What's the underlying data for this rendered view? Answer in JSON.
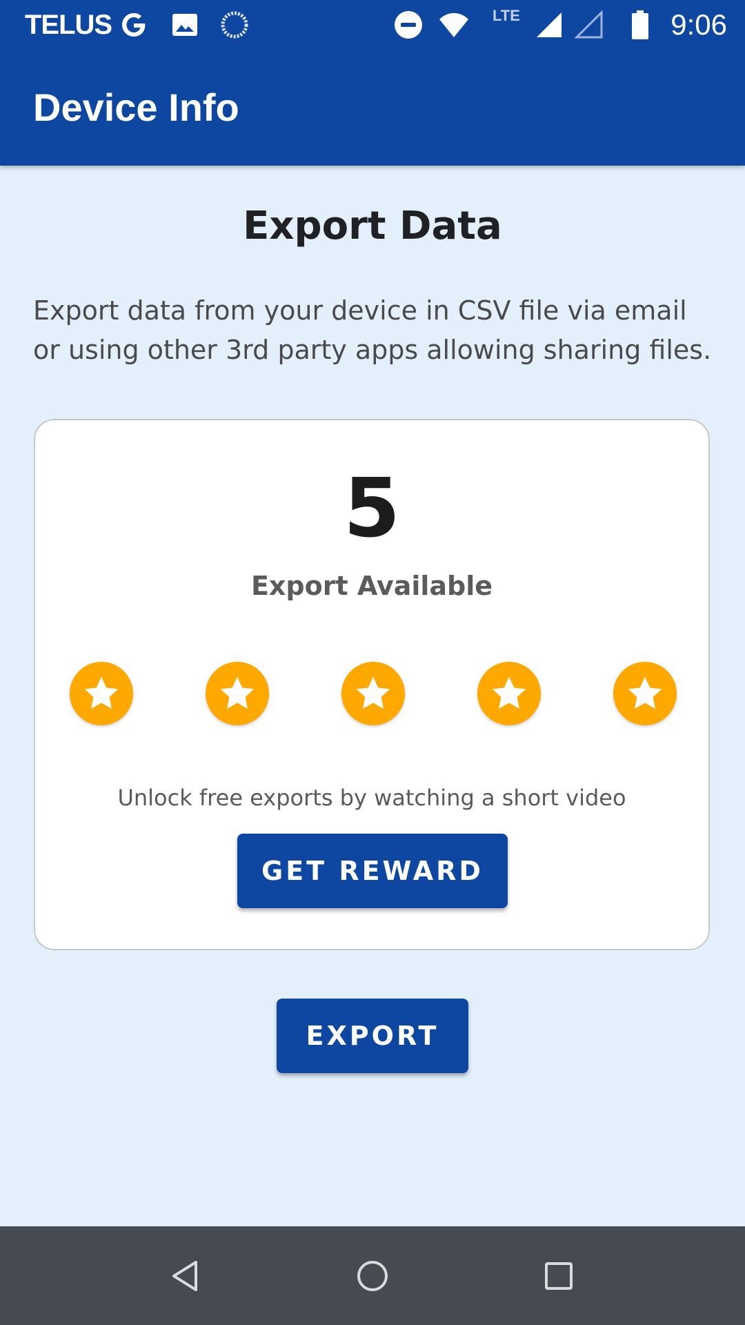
{
  "status_bar": {
    "carrier": "TELUS",
    "lte_label": "LTE",
    "time": "9:06",
    "icons": [
      "google-icon",
      "image-icon",
      "sync-icon",
      "do-not-disturb-icon",
      "wifi-icon",
      "signal-icon",
      "signal-empty-icon",
      "battery-icon"
    ]
  },
  "app_bar": {
    "title": "Device Info"
  },
  "main": {
    "title": "Export Data",
    "description": "Export data from your device in CSV file via email or using other 3rd party apps allowing sharing files.",
    "card": {
      "count": "5",
      "count_label": "Export Available",
      "stars_filled": 5,
      "stars_total": 5,
      "star_color": "#ffa800",
      "unlock_text": "Unlock free exports by watching a short video",
      "reward_button": "GET REWARD"
    },
    "export_button": "EXPORT"
  },
  "nav_bar": {
    "icons": [
      "back-icon",
      "home-icon",
      "recents-icon"
    ]
  },
  "colors": {
    "primary": "#0e47a1",
    "background": "#e3f0fb",
    "nav_bar": "#454b51"
  }
}
